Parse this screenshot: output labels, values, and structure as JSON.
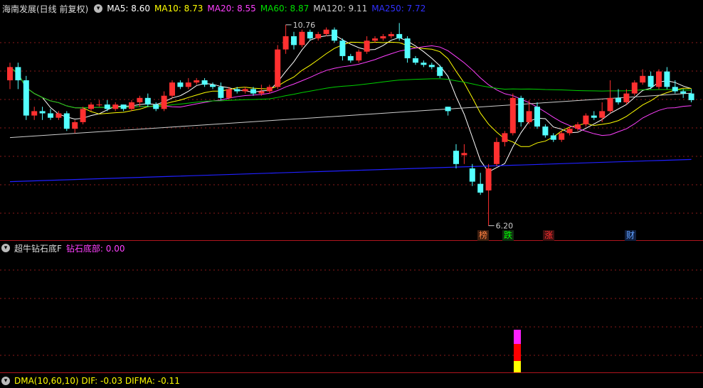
{
  "main": {
    "title": "海南发展(日线 前复权)",
    "ma": [
      {
        "label": "MA5: 8.60",
        "color": "#ffffff"
      },
      {
        "label": "MA10: 8.73",
        "color": "#ffff00"
      },
      {
        "label": "MA20: 8.55",
        "color": "#ff40ff"
      },
      {
        "label": "MA60: 8.87",
        "color": "#00e000"
      },
      {
        "label": "MA120: 9.11",
        "color": "#cccccc"
      },
      {
        "label": "MA250: 7.72",
        "color": "#2020ff"
      }
    ],
    "high_label": "10.76",
    "low_label": "6.20",
    "badges": [
      {
        "text": "榜",
        "color": "#ff8040"
      },
      {
        "text": "跌",
        "color": "#00ff00"
      },
      {
        "text": "涨",
        "color": "#ff3030"
      },
      {
        "text": "财",
        "color": "#60a0ff"
      }
    ]
  },
  "panel2": {
    "title": "超牛钻石底F",
    "indicator": "钻石底部: 0.00",
    "indicator_color": "#ff40ff"
  },
  "panel3": {
    "text": "DMA(10,60,10) DIF: -0.03 DIFMA: -0.11"
  },
  "colors": {
    "up": "#ff3030",
    "down": "#54ffff",
    "grid": "#8a1a1a"
  },
  "chart_data": {
    "type": "candlestick",
    "ylim": [
      6.0,
      11.0
    ],
    "candles": [
      [
        9.5,
        9.8,
        9.3,
        9.9
      ],
      [
        9.8,
        9.5,
        9.3,
        9.9
      ],
      [
        9.5,
        8.7,
        8.6,
        9.6
      ],
      [
        8.7,
        8.8,
        8.6,
        8.9
      ],
      [
        8.8,
        8.75,
        8.6,
        8.9
      ],
      [
        8.75,
        8.65,
        8.6,
        8.85
      ],
      [
        8.65,
        8.75,
        8.6,
        8.8
      ],
      [
        8.75,
        8.4,
        8.35,
        8.8
      ],
      [
        8.4,
        8.55,
        8.3,
        8.6
      ],
      [
        8.55,
        8.85,
        8.5,
        8.9
      ],
      [
        8.85,
        8.95,
        8.8,
        9.0
      ],
      [
        8.95,
        8.95,
        8.9,
        9.05
      ],
      [
        8.95,
        8.85,
        8.8,
        9.05
      ],
      [
        8.85,
        8.95,
        8.8,
        9.0
      ],
      [
        8.95,
        8.85,
        8.8,
        8.95
      ],
      [
        8.85,
        9.0,
        8.8,
        9.05
      ],
      [
        9.0,
        9.1,
        8.9,
        9.15
      ],
      [
        9.1,
        8.95,
        8.9,
        9.2
      ],
      [
        8.95,
        8.85,
        8.8,
        9.0
      ],
      [
        8.85,
        9.15,
        8.8,
        9.25
      ],
      [
        9.15,
        9.45,
        9.1,
        9.5
      ],
      [
        9.45,
        9.35,
        9.3,
        9.5
      ],
      [
        9.35,
        9.45,
        9.3,
        9.55
      ],
      [
        9.45,
        9.5,
        9.4,
        9.55
      ],
      [
        9.5,
        9.4,
        9.35,
        9.55
      ],
      [
        9.4,
        9.35,
        9.3,
        9.45
      ],
      [
        9.35,
        9.1,
        9.05,
        9.45
      ],
      [
        9.1,
        9.3,
        9.05,
        9.35
      ],
      [
        9.3,
        9.25,
        9.2,
        9.35
      ],
      [
        9.25,
        9.3,
        9.2,
        9.35
      ],
      [
        9.3,
        9.2,
        9.15,
        9.35
      ],
      [
        9.2,
        9.25,
        9.15,
        9.4
      ],
      [
        9.25,
        9.35,
        9.2,
        9.4
      ],
      [
        9.35,
        10.2,
        9.3,
        10.3
      ],
      [
        10.2,
        10.5,
        10.1,
        10.76
      ],
      [
        10.5,
        10.3,
        10.2,
        10.6
      ],
      [
        10.3,
        10.6,
        10.25,
        10.65
      ],
      [
        10.6,
        10.45,
        10.4,
        10.65
      ],
      [
        10.45,
        10.55,
        10.4,
        10.6
      ],
      [
        10.55,
        10.65,
        10.5,
        10.7
      ],
      [
        10.65,
        10.4,
        10.35,
        10.7
      ],
      [
        10.4,
        10.05,
        9.95,
        10.45
      ],
      [
        10.05,
        9.95,
        9.9,
        10.1
      ],
      [
        9.95,
        10.15,
        9.9,
        10.2
      ],
      [
        10.15,
        10.4,
        10.1,
        10.5
      ],
      [
        10.4,
        10.45,
        10.35,
        10.5
      ],
      [
        10.45,
        10.5,
        10.4,
        10.55
      ],
      [
        10.5,
        10.55,
        10.45,
        10.6
      ],
      [
        10.55,
        10.45,
        10.4,
        10.8
      ],
      [
        10.45,
        10.0,
        9.9,
        10.5
      ],
      [
        10.0,
        9.9,
        9.85,
        10.05
      ],
      [
        9.9,
        9.85,
        9.8,
        9.95
      ],
      [
        9.85,
        9.8,
        9.75,
        9.9
      ],
      [
        9.8,
        9.6,
        9.55,
        9.85
      ],
      [
        8.9,
        8.8,
        8.7,
        8.9
      ],
      [
        7.9,
        7.6,
        7.5,
        8.05
      ],
      [
        7.8,
        7.85,
        7.6,
        8.05
      ],
      [
        7.5,
        7.2,
        7.1,
        7.6
      ],
      [
        7.15,
        6.95,
        6.9,
        7.4
      ],
      [
        7.0,
        7.5,
        6.2,
        7.6
      ],
      [
        7.6,
        8.1,
        7.55,
        8.2
      ],
      [
        8.1,
        8.3,
        8.0,
        8.35
      ],
      [
        8.3,
        9.1,
        8.25,
        9.2
      ],
      [
        9.1,
        8.55,
        8.45,
        9.15
      ],
      [
        8.55,
        8.8,
        8.5,
        9.05
      ],
      [
        8.9,
        8.45,
        8.4,
        9.0
      ],
      [
        8.45,
        8.25,
        8.2,
        8.5
      ],
      [
        8.25,
        8.15,
        8.1,
        8.3
      ],
      [
        8.15,
        8.3,
        8.1,
        8.35
      ],
      [
        8.3,
        8.4,
        8.25,
        8.45
      ],
      [
        8.4,
        8.5,
        8.35,
        8.55
      ],
      [
        8.5,
        8.7,
        8.45,
        8.75
      ],
      [
        8.7,
        8.65,
        8.6,
        8.8
      ],
      [
        8.65,
        8.8,
        8.55,
        9.0
      ],
      [
        8.8,
        9.1,
        8.75,
        9.5
      ],
      [
        9.1,
        9.0,
        8.95,
        9.3
      ],
      [
        9.0,
        9.2,
        8.95,
        9.3
      ],
      [
        9.2,
        9.45,
        9.15,
        9.5
      ],
      [
        9.45,
        9.6,
        9.4,
        9.75
      ],
      [
        9.6,
        9.35,
        9.3,
        9.7
      ],
      [
        9.35,
        9.7,
        9.3,
        9.75
      ],
      [
        9.7,
        9.35,
        9.3,
        9.8
      ],
      [
        9.35,
        9.25,
        9.2,
        9.5
      ],
      [
        9.25,
        9.2,
        9.1,
        9.3
      ],
      [
        9.2,
        9.05,
        9.0,
        9.3
      ]
    ],
    "ma_series": [
      "MA5",
      "MA10",
      "MA20",
      "MA60",
      "MA120",
      "MA250"
    ],
    "bar_segments": [
      {
        "color": "#ffff00",
        "from": 0.0,
        "to": 0.4
      },
      {
        "color": "#ff0000",
        "from": 0.4,
        "to": 1.0
      },
      {
        "color": "#ff20ff",
        "from": 1.0,
        "to": 1.5
      }
    ]
  }
}
